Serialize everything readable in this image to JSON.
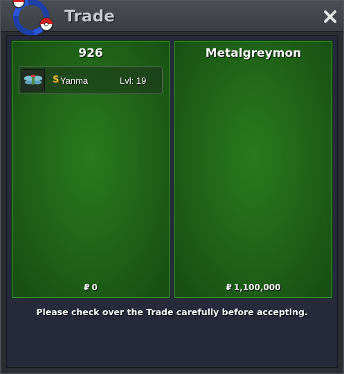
{
  "window": {
    "title": "Trade"
  },
  "icons": {
    "logo": "trade-logo-icon",
    "close": "close-icon",
    "pokemon": "yanma-icon"
  },
  "colors": {
    "panel_green": "#236b19",
    "shiny_gold": "#f0c020",
    "background": "#262a3a"
  },
  "left_panel": {
    "trainer": "926",
    "pokemon": [
      {
        "shiny_mark": "S",
        "name": "Yanma",
        "level": "Lvl: 19"
      }
    ],
    "money_symbol": "₽",
    "money": "0"
  },
  "right_panel": {
    "trainer": "Metalgreymon",
    "pokemon": [],
    "money_symbol": "₽",
    "money": "1,100,000"
  },
  "notice": "Please check over the Trade carefully before accepting."
}
